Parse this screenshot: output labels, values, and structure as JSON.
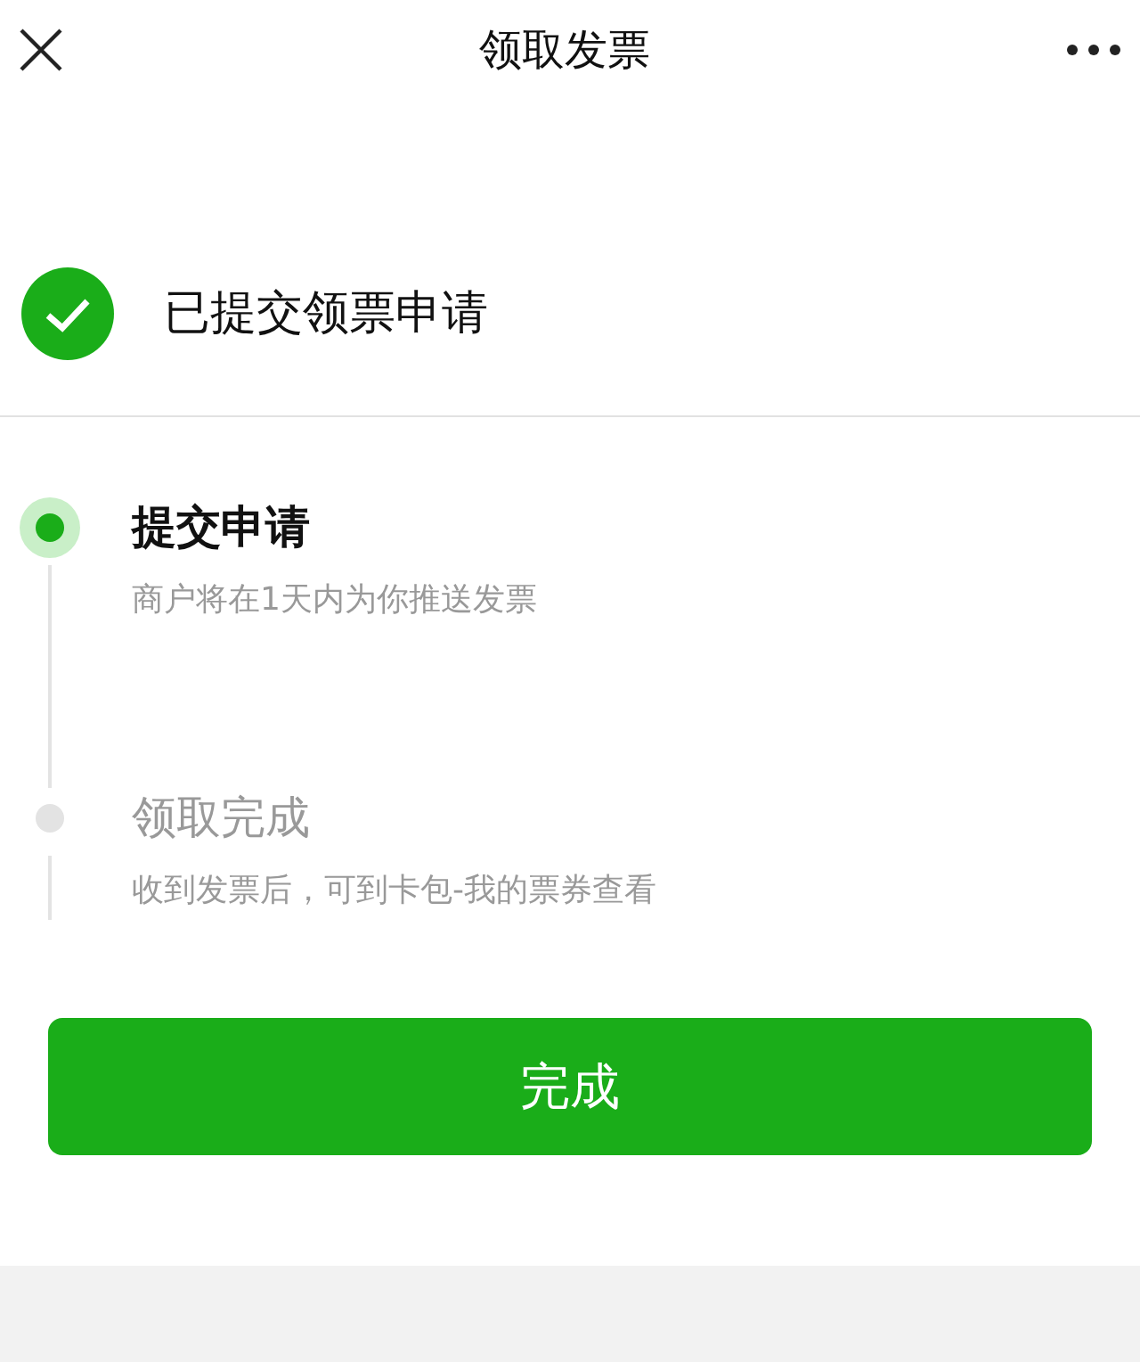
{
  "window": {
    "title": "领取发票"
  },
  "status": {
    "text": "已提交领票申请"
  },
  "steps": [
    {
      "title": "提交申请",
      "description": "商户将在1天内为你推送发票",
      "active": true
    },
    {
      "title": "领取完成",
      "description": "收到发票后，可到卡包-我的票券查看",
      "active": false
    }
  ],
  "buttons": [
    "完成"
  ]
}
